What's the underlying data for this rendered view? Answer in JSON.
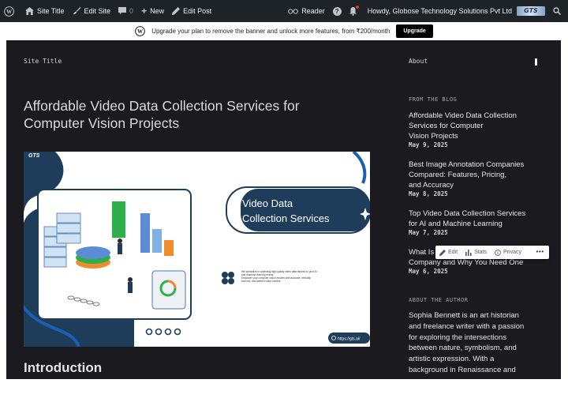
{
  "adminbar": {
    "site_title": "Site Title",
    "edit_site": "Edit Site",
    "comments_count": "0",
    "new_label": "New",
    "edit_post": "Edit Post",
    "reader": "Reader",
    "help": "?",
    "howdy": "Howdy, Globose Technology Solutions Pvt Ltd",
    "avatar_text": "GTS"
  },
  "banner": {
    "text": "Upgrade your plan to remove the banner and unlock more features, from ₹200/month",
    "button": "Upgrade"
  },
  "header": {
    "site_title": "Site Title",
    "about": "About"
  },
  "post": {
    "title": "Affordable Video Data Collection Services for Computer Vision Projects",
    "intro_heading": "Introduction"
  },
  "featured_image": {
    "brand": "GTS",
    "heading_line1": "Video Data",
    "heading_line2": "Collection Services",
    "blurb_line1": "We specialize in collecting high-quality video data tailored to your AI",
    "blurb_line2": "and machine learning needs.",
    "blurb_line3": "Empower your computer vision models with accurate, ethically",
    "blurb_line4": "sourced, and labeled video content.",
    "url": "https://gts.ai/"
  },
  "sidebar": {
    "from_blog": "FROM THE BLOG",
    "posts": [
      {
        "l1": "Affordable Video Data Collection",
        "l2": "Services for Computer",
        "l3": "Vision Projects",
        "date": "May 9, 2025"
      },
      {
        "l1": "Best Image Annotation Companies",
        "l2": "Compared: Features, Pricing,",
        "l3": "and Accuracy",
        "date": "May 8, 2025"
      },
      {
        "l1": "Top Video Data Collection Services",
        "l2": "for AI and Machine Learning",
        "l3": "",
        "date": "May 7, 2025"
      },
      {
        "l1": "What Is",
        "l2": "Company and Why You Need One",
        "l3": "",
        "date": "May 6, 2025"
      }
    ],
    "about_author": "ABOUT THE AUTHOR",
    "bio": [
      "Sophia Bennett is an art historian",
      "and freelance writer with a passion",
      "for exploring the intersections",
      "between nature, symbolism, and",
      "artistic expression. With a",
      "background in Renaissance and"
    ]
  },
  "toolbar": {
    "edit": "Edit",
    "stats": "Stats",
    "privacy": "Privacy",
    "more": "•••"
  },
  "colors": {
    "adminbar": "#1d2327",
    "site_bg": "#1b1b1f",
    "accent_navy": "#1e3d5a",
    "accent_green": "#2db04b"
  }
}
